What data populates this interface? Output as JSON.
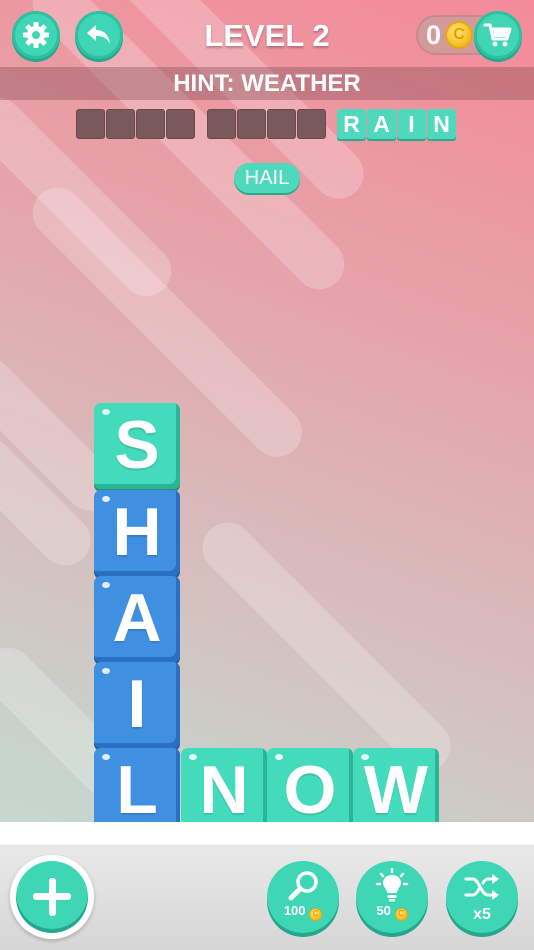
{
  "header": {
    "level_title": "LEVEL 2",
    "coin_count": "0",
    "coin_symbol": "C",
    "settings_icon": "gear-icon",
    "back_icon": "undo-arrow-icon",
    "shop_icon": "shopping-cart-icon"
  },
  "hint": {
    "text": "HINT: WEATHER"
  },
  "answers": [
    {
      "length": 4,
      "solved": false,
      "letters": []
    },
    {
      "length": 4,
      "solved": false,
      "letters": []
    },
    {
      "length": 4,
      "solved": true,
      "letters": [
        "R",
        "A",
        "I",
        "N"
      ]
    }
  ],
  "found_word": "HAIL",
  "board": {
    "tiles": [
      {
        "letter": "S",
        "color": "teal"
      },
      {
        "letter": "H",
        "color": "blue"
      },
      {
        "letter": "A",
        "color": "blue"
      },
      {
        "letter": "I",
        "color": "blue"
      },
      {
        "letter": "L",
        "color": "blue"
      },
      {
        "letter": "N",
        "color": "teal"
      },
      {
        "letter": "O",
        "color": "teal"
      },
      {
        "letter": "W",
        "color": "teal"
      }
    ]
  },
  "tools": {
    "add_icon": "plus-icon",
    "magnifier": {
      "icon": "magnifier-icon",
      "cost": "100"
    },
    "hint": {
      "icon": "lightbulb-icon",
      "cost": "50"
    },
    "shuffle": {
      "icon": "shuffle-icon",
      "count": "x5"
    }
  },
  "colors": {
    "teal": "#44dbbd",
    "blue": "#4090e2",
    "coin": "#f6c22a"
  }
}
